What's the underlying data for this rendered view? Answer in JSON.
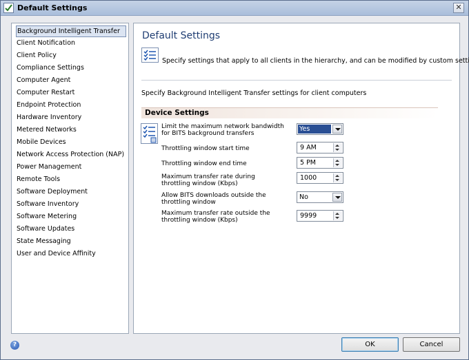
{
  "window": {
    "title": "Default Settings",
    "close_glyph": "✕"
  },
  "nav": {
    "items": [
      {
        "label": "Background Intelligent Transfer",
        "selected": true
      },
      {
        "label": "Client Notification"
      },
      {
        "label": "Client Policy"
      },
      {
        "label": "Compliance Settings"
      },
      {
        "label": "Computer Agent"
      },
      {
        "label": "Computer Restart"
      },
      {
        "label": "Endpoint Protection"
      },
      {
        "label": "Hardware Inventory"
      },
      {
        "label": "Metered Networks"
      },
      {
        "label": "Mobile Devices"
      },
      {
        "label": "Network Access Protection (NAP)"
      },
      {
        "label": "Power Management"
      },
      {
        "label": "Remote Tools"
      },
      {
        "label": "Software Deployment"
      },
      {
        "label": "Software Inventory"
      },
      {
        "label": "Software Metering"
      },
      {
        "label": "Software Updates"
      },
      {
        "label": "State Messaging"
      },
      {
        "label": "User and Device Affinity"
      }
    ]
  },
  "content": {
    "title": "Default Settings",
    "intro": "Specify settings that apply to all clients in the hierarchy, and can be modified by custom settings.",
    "subtitle": "Specify Background Intelligent Transfer settings for client computers",
    "section_title": "Device Settings",
    "settings": [
      {
        "label": "Limit the maximum network bandwidth for BITS background transfers",
        "control": "dropdown",
        "value": "Yes",
        "focused": true
      },
      {
        "label": "Throttling window start time",
        "control": "spinner",
        "value": "9 AM"
      },
      {
        "label": "Throttling window end time",
        "control": "spinner",
        "value": "5 PM"
      },
      {
        "label": "Maximum transfer rate during throttling window (Kbps)",
        "control": "spinner",
        "value": "1000"
      },
      {
        "label": "Allow BITS downloads outside the throttling window",
        "control": "dropdown",
        "value": "No"
      },
      {
        "label": "Maximum transfer rate outside the throttling window (Kbps)",
        "control": "spinner",
        "value": "9999"
      }
    ]
  },
  "footer": {
    "help_glyph": "?",
    "ok_label": "OK",
    "cancel_label": "Cancel"
  },
  "colors": {
    "title_text": "#1f3d72",
    "selection": "#2a4f94",
    "nav_selected_bg": "#dbe4f2"
  },
  "icons": [
    "window-app-icon",
    "close-icon",
    "checklist-icon",
    "settings-checklist-icon",
    "help-icon"
  ]
}
